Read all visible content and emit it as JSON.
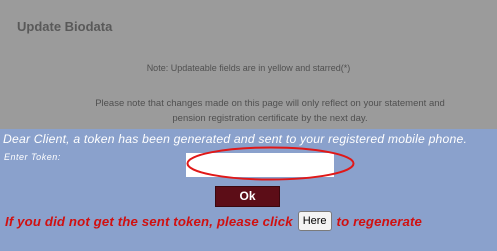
{
  "page": {
    "title": "Update Biodata",
    "note": "Note: Updateable fields are in yellow and starred(*)",
    "info_line1": "Please note that changes made on this page will only reflect on your statement and",
    "info_line2": "pension registration certificate by the next day."
  },
  "token": {
    "message": "Dear Client, a token has been generated and sent to your registered mobile phone.",
    "label": "Enter Token:",
    "input_value": "",
    "ok_label": "Ok",
    "resend_prefix": "If you did not get the sent token, please click",
    "here_label": "Here",
    "resend_suffix": "to regenerate"
  },
  "colors": {
    "grey_panel": "#9b9b9b",
    "token_panel": "#8aa1cc",
    "ok_button": "#5c0d17",
    "resend_text": "#d01010",
    "annotation_ellipse": "#e01818"
  }
}
